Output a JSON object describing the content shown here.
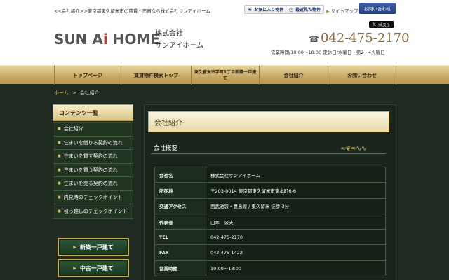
{
  "header": {
    "tagline": "<<会社紹介>>東京都東久留米市の賃貸・売買なら株式会社サンアイホーム",
    "favorites_label": "お気に入り物件",
    "recent_label": "最近見た物件",
    "sitemap_label": "サイトマップ",
    "contact_label": "お問い合わせ",
    "post_label": "ポスト",
    "logo_text_1": "SUN A",
    "logo_text_i": "i",
    "logo_text_2": " HOME",
    "company_line1": "株式会社",
    "company_line2": "サンアイホーム",
    "phone": "042-475-2170",
    "hours": "営業時間/10:00～18:00 定休日/水曜日・第2・4火曜日"
  },
  "nav": {
    "items": [
      "トップページ",
      "賃貸物件検索トップ",
      "東久留米市学町1丁目新築一戸建て",
      "会社紹介",
      "お問い合わせ"
    ]
  },
  "breadcrumb": {
    "home": "ホーム",
    "sep": ">",
    "current": "会社紹介"
  },
  "sidebar": {
    "title": "コンテンツ一覧",
    "items": [
      "会社紹介",
      "住まいを借りる契約の流れ",
      "住まいを貸す契約の流れ",
      "住まいを買う契約の流れ",
      "住まいを売る契約の流れ",
      "内見時のチェックポイント",
      "引っ越しのチェックポイント"
    ],
    "banners": [
      "新築一戸建て",
      "中古一戸建て"
    ]
  },
  "main": {
    "title": "会社紹介",
    "subtitle": "会社概要",
    "rows": [
      {
        "k": "会社名",
        "v": "株式会社サンアイホーム"
      },
      {
        "k": "所在地",
        "v": "〒203-0014 東京都東久留米市東本町6-6"
      },
      {
        "k": "交通アクセス",
        "v": "西武池袋・豊島線 / 東久留米 徒歩 3分"
      },
      {
        "k": "代表者",
        "v": "山本　公夫"
      },
      {
        "k": "TEL",
        "v": "042-475-2170"
      },
      {
        "k": "FAX",
        "v": "042-475-1423"
      },
      {
        "k": "営業時間",
        "v": "10:00〜18:00"
      }
    ]
  },
  "colors": {
    "gold": "#c9ad5c",
    "background": "#1f2a20",
    "navy": "#1a2b6d"
  }
}
